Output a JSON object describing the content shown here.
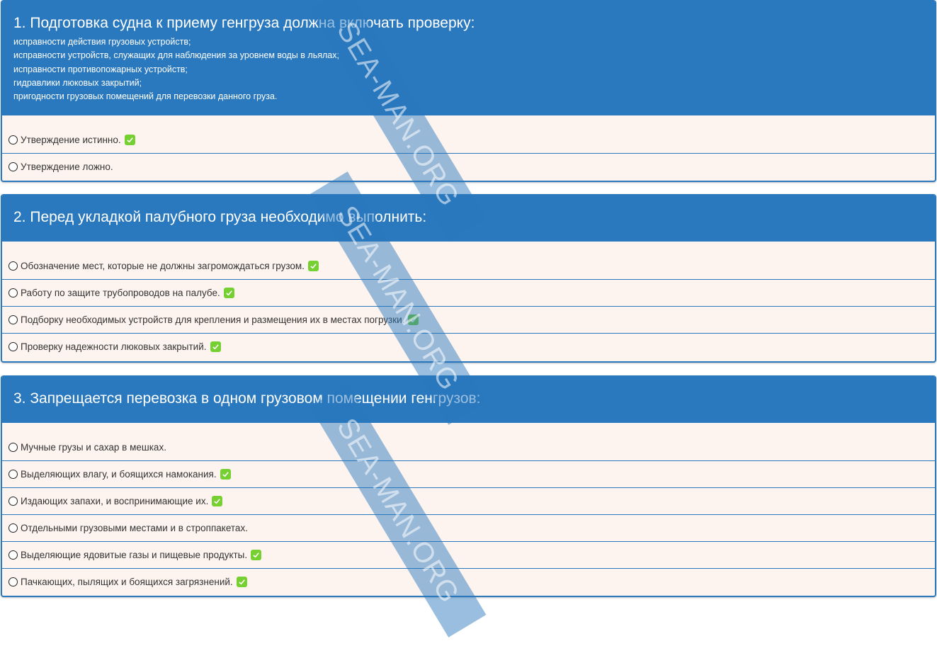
{
  "questions": [
    {
      "title": "1. Подготовка судна к приему генгруза должна включать проверку:",
      "sub": [
        "исправности действия грузовых устройств;",
        "исправности устройств, служащих для наблюдения за уровнем воды в льялах;",
        "исправности противопожарных устройств;",
        "гидравлики люковых закрытий;",
        "пригодности грузовых помещений для перевозки данного груза."
      ],
      "answers": [
        {
          "text": "Утверждение истинно.",
          "correct": true
        },
        {
          "text": "Утверждение ложно.",
          "correct": false
        }
      ]
    },
    {
      "title": "2. Перед укладкой палубного груза необходимо выполнить:",
      "answers": [
        {
          "text": "Обозначение мест, которые не должны загромождаться грузом.",
          "correct": true
        },
        {
          "text": "Работу по защите трубопроводов на палубе.",
          "correct": true
        },
        {
          "text": "Подборку необходимых устройств для крепления и размещения их в местах погрузки.",
          "correct": true
        },
        {
          "text": "Проверку надежности люковых закрытий.",
          "correct": true
        }
      ]
    },
    {
      "title": "3. Запрещается перевозка в одном грузовом помещении генгрузов:",
      "answers": [
        {
          "text": "Мучные грузы и сахар в мешках.",
          "correct": false
        },
        {
          "text": "Выделяющих влагу, и боящихся намокания.",
          "correct": true
        },
        {
          "text": "Издающих запахи, и воспринимающие их.",
          "correct": true
        },
        {
          "text": "Отдельными грузовыми местами и в строппакетах.",
          "correct": false
        },
        {
          "text": "Выделяющие ядовитые газы и пищевые продукты.",
          "correct": true
        },
        {
          "text": "Пачкающих, пылящих и боящихся загрязнений.",
          "correct": true
        }
      ]
    }
  ],
  "watermark": "SEA-MAN.ORG",
  "colors": {
    "header": "#2a78bd",
    "body": "#fdf4ef",
    "check": "#76d031"
  },
  "icons": {
    "radio": "radio-circle-icon",
    "correct": "check-mark-icon"
  }
}
